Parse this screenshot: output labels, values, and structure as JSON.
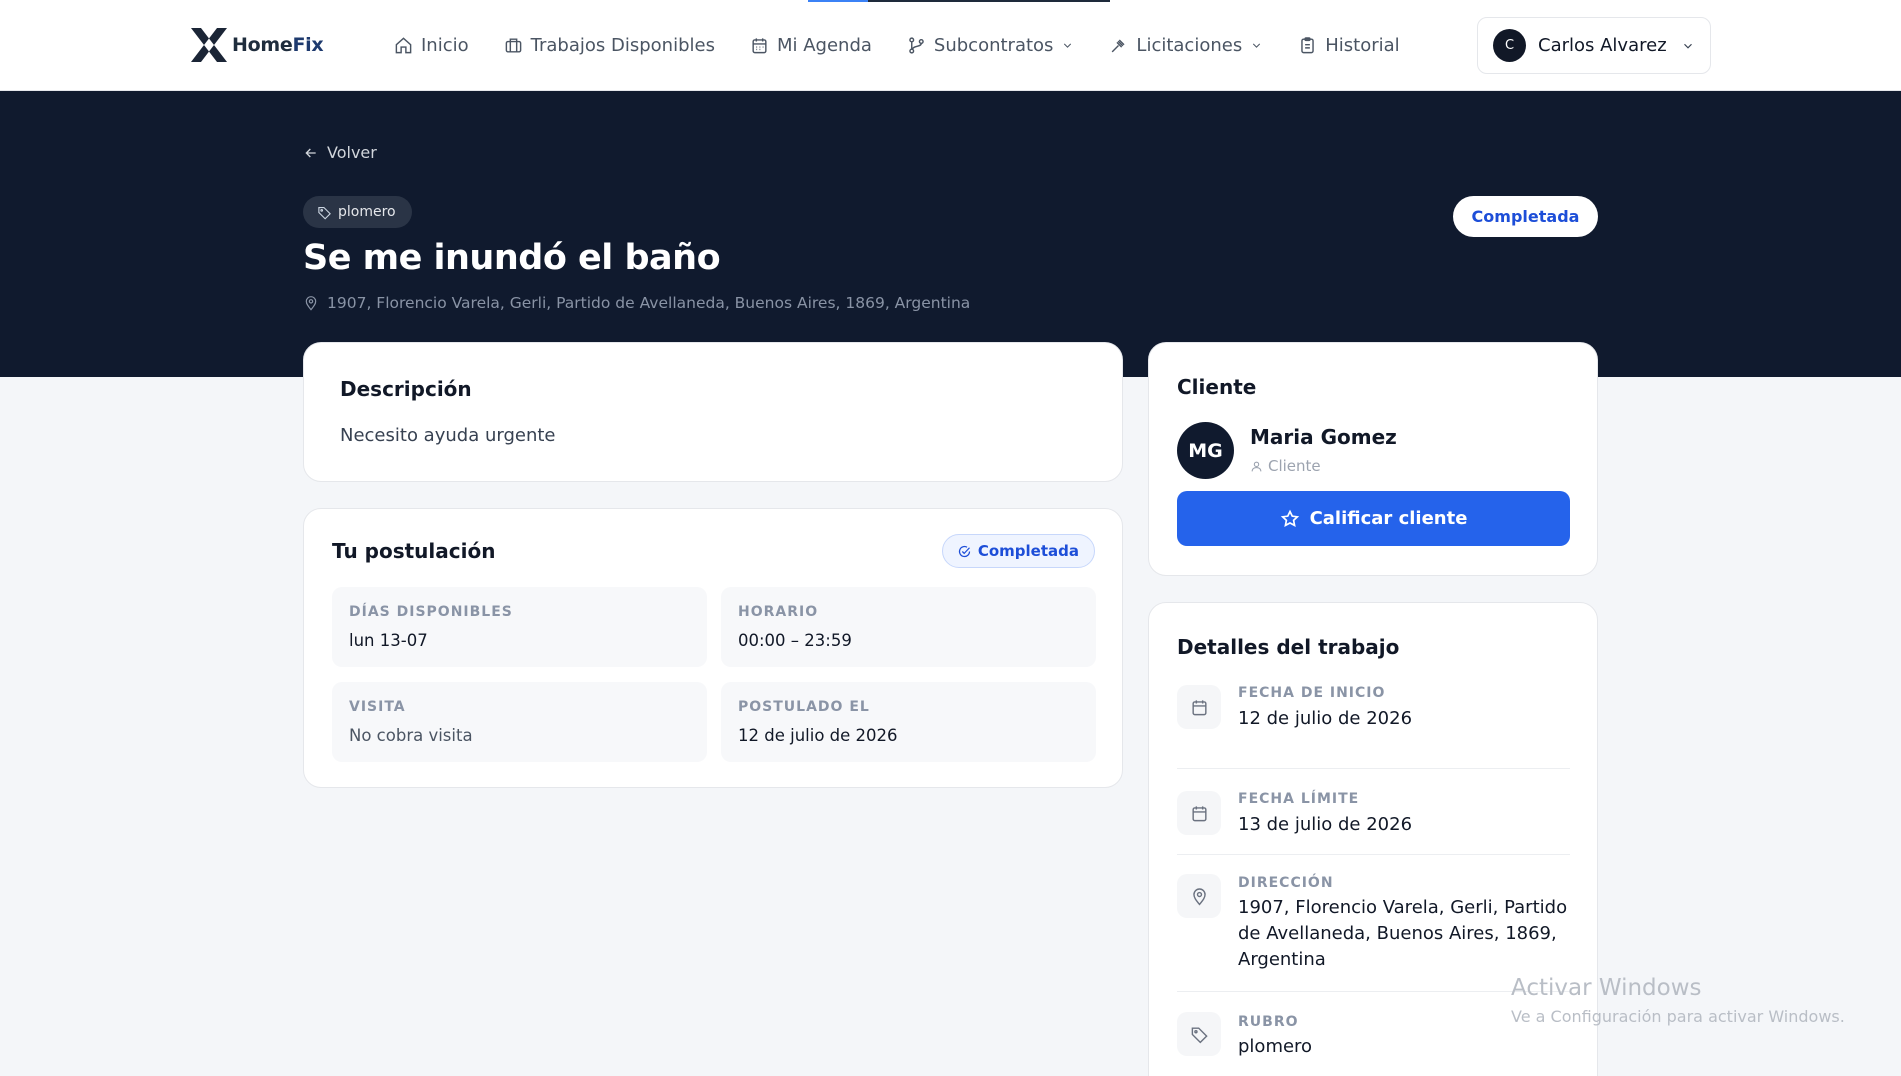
{
  "brand": {
    "name_home": "Home",
    "name_fix": "Fix"
  },
  "nav": {
    "items": [
      {
        "label": "Inicio",
        "icon": "home-icon"
      },
      {
        "label": "Trabajos Disponibles",
        "icon": "briefcase-icon"
      },
      {
        "label": "Mi Agenda",
        "icon": "calendar-icon"
      },
      {
        "label": "Subcontratos",
        "icon": "git-branch-icon"
      },
      {
        "label": "Licitaciones",
        "icon": "gavel-icon"
      },
      {
        "label": "Historial",
        "icon": "clipboard-icon"
      }
    ]
  },
  "user": {
    "initial": "C",
    "name": "Carlos Alvarez"
  },
  "hero": {
    "back_label": "Volver",
    "category": "plomero",
    "title": "Se me inundó el baño",
    "location": "1907, Florencio Varela, Gerli, Partido de Avellaneda, Buenos Aires, 1869, Argentina",
    "status": "Completada"
  },
  "description": {
    "title": "Descripción",
    "text": "Necesito ayuda urgente"
  },
  "application": {
    "title": "Tu postulación",
    "status": "Completada",
    "fields": [
      {
        "label": "DÍAS DISPONIBLES",
        "value": "lun 13-07"
      },
      {
        "label": "HORARIO",
        "value": "00:00 – 23:59"
      },
      {
        "label": "VISITA",
        "value": "No cobra visita"
      },
      {
        "label": "POSTULADO EL",
        "value": "12 de julio de 2026"
      }
    ]
  },
  "client": {
    "title": "Cliente",
    "initials": "MG",
    "name": "Maria Gomez",
    "role": "Cliente",
    "rate_label": "Calificar cliente"
  },
  "details": {
    "title": "Detalles del trabajo",
    "rows": [
      {
        "label": "FECHA DE INICIO",
        "value": "12 de julio de 2026",
        "icon": "calendar-icon"
      },
      {
        "label": "FECHA LÍMITE",
        "value": "13 de julio de 2026",
        "icon": "calendar-icon"
      },
      {
        "label": "DIRECCIÓN",
        "value": "1907, Florencio Varela, Gerli, Partido de Avellaneda, Buenos Aires, 1869, Argentina",
        "icon": "map-pin-icon"
      },
      {
        "label": "RUBRO",
        "value": "plomero",
        "icon": "tag-icon"
      }
    ]
  },
  "watermark": {
    "title": "Activar Windows",
    "subtitle": "Ve a Configuración para activar Windows."
  },
  "colors": {
    "navy": "#101a2e",
    "accent": "#2563eb",
    "page": "#f4f6f9"
  }
}
